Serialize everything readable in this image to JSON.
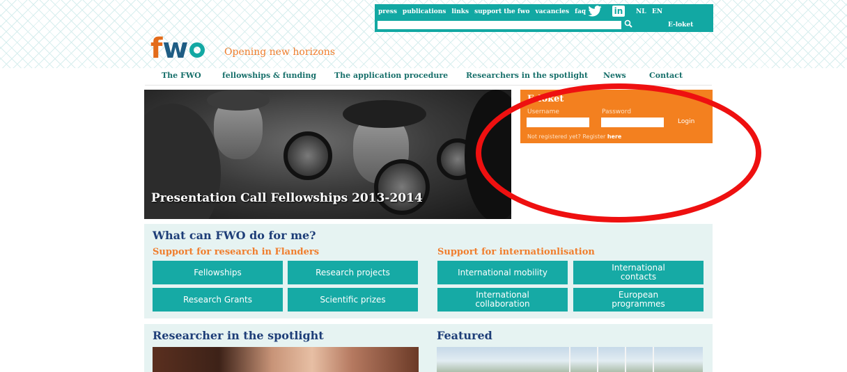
{
  "topbar": {
    "links": [
      "press",
      "publications",
      "links",
      "support the fwo",
      "vacancies",
      "faq"
    ],
    "lang_nl": "NL",
    "lang_en": "EN",
    "eloket_link": "E-loket",
    "search_value": ""
  },
  "logo": {
    "letters_f": "f",
    "letters_w": "w",
    "tagline": "Opening new horizons"
  },
  "nav": {
    "items": [
      "The FWO",
      "fellowships & funding",
      "The application procedure",
      "Researchers in the spotlight",
      "News",
      "Contact"
    ]
  },
  "hero": {
    "caption": "Presentation Call Fellowships 2013-2014"
  },
  "eloket": {
    "title": "E-loket",
    "username_label": "Username",
    "password_label": "Password",
    "username_value": "",
    "password_value": "",
    "login_label": "Login",
    "register_text": "Not registered yet? Register",
    "register_link": "here"
  },
  "what": {
    "title": "What can FWO do for me?",
    "left_heading": "Support for research in Flanders",
    "right_heading": "Support for internationlisation",
    "left_tiles": [
      "Fellowships",
      "Research projects",
      "Research Grants",
      "Scientific prizes"
    ],
    "right_tiles": [
      "International mobility",
      "International contacts",
      "International collaboration",
      "European programmes"
    ]
  },
  "bottom": {
    "spotlight_title": "Researcher in the spotlight",
    "featured_title": "Featured"
  },
  "colors": {
    "teal": "#12a8a3",
    "orange": "#f3801f",
    "navy": "#1e3e78",
    "annotation_red": "#ee1010"
  },
  "icons": {
    "twitter": "twitter-icon",
    "linkedin": "linkedin-icon",
    "search": "search-icon"
  }
}
